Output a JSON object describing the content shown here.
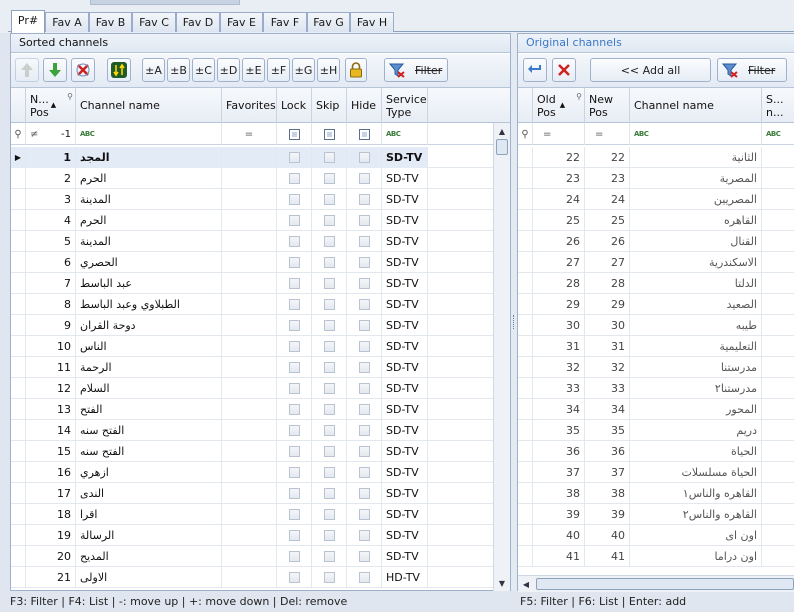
{
  "tabs": [
    {
      "label": "Pr#"
    },
    {
      "label": "Fav A"
    },
    {
      "label": "Fav B"
    },
    {
      "label": "Fav C"
    },
    {
      "label": "Fav D"
    },
    {
      "label": "Fav E"
    },
    {
      "label": "Fav F"
    },
    {
      "label": "Fav G"
    },
    {
      "label": "Fav H"
    }
  ],
  "sorted": {
    "title": "Sorted channels",
    "toolbar": {
      "fav_a": "±A",
      "fav_b": "±B",
      "fav_c": "±C",
      "fav_d": "±D",
      "fav_e": "±E",
      "fav_f": "±F",
      "fav_g": "±G",
      "fav_h": "±H",
      "filter": "Filter"
    },
    "columns": {
      "pos": "N...\nPos",
      "name": "Channel name",
      "favorites": "Favorites",
      "lock": "Lock",
      "skip": "Skip",
      "hide": "Hide",
      "service": "Service\nType"
    },
    "filter_row": {
      "neq": "≠",
      "pos_value": "-1",
      "eq": "="
    },
    "rows": [
      {
        "pos": "1",
        "name": "المجد",
        "type": "SD-TV"
      },
      {
        "pos": "2",
        "name": "الحرم",
        "type": "SD-TV"
      },
      {
        "pos": "3",
        "name": "المدينة",
        "type": "SD-TV"
      },
      {
        "pos": "4",
        "name": "الحرم",
        "type": "SD-TV"
      },
      {
        "pos": "5",
        "name": "المدينة",
        "type": "SD-TV"
      },
      {
        "pos": "6",
        "name": "الحصري",
        "type": "SD-TV"
      },
      {
        "pos": "7",
        "name": "عبد الباسط",
        "type": "SD-TV"
      },
      {
        "pos": "8",
        "name": "الطبلاوي وعبد الباسط",
        "type": "SD-TV"
      },
      {
        "pos": "9",
        "name": "دوحة القران",
        "type": "SD-TV"
      },
      {
        "pos": "10",
        "name": "الناس",
        "type": "SD-TV"
      },
      {
        "pos": "11",
        "name": "الرحمة",
        "type": "SD-TV"
      },
      {
        "pos": "12",
        "name": "السلام",
        "type": "SD-TV"
      },
      {
        "pos": "13",
        "name": "الفتح",
        "type": "SD-TV"
      },
      {
        "pos": "14",
        "name": "الفتح سنه",
        "type": "SD-TV"
      },
      {
        "pos": "15",
        "name": "الفتح سنه",
        "type": "SD-TV"
      },
      {
        "pos": "16",
        "name": "ازهري",
        "type": "SD-TV"
      },
      {
        "pos": "17",
        "name": "الندى",
        "type": "SD-TV"
      },
      {
        "pos": "18",
        "name": "اقرا",
        "type": "SD-TV"
      },
      {
        "pos": "19",
        "name": "الرسالة",
        "type": "SD-TV"
      },
      {
        "pos": "20",
        "name": "المديح",
        "type": "SD-TV"
      },
      {
        "pos": "21",
        "name": "الاولى",
        "type": "HD-TV"
      }
    ],
    "status": "F3: Filter | F4: List | -: move up | +: move down | Del: remove"
  },
  "original": {
    "title": "Original channels",
    "toolbar": {
      "add_all": "<< Add all",
      "filter": "Filter"
    },
    "columns": {
      "old_pos": "Old\nPos",
      "new_pos": "New\nPos",
      "name": "Channel name",
      "s": "S...\nn..."
    },
    "filter_row": {
      "eq": "="
    },
    "rows": [
      {
        "old": "22",
        "new": "22",
        "name": "الثانية"
      },
      {
        "old": "23",
        "new": "23",
        "name": "المصرية"
      },
      {
        "old": "24",
        "new": "24",
        "name": "المصريين"
      },
      {
        "old": "25",
        "new": "25",
        "name": "القاهره"
      },
      {
        "old": "26",
        "new": "26",
        "name": "القنال"
      },
      {
        "old": "27",
        "new": "27",
        "name": "الاسكندرية"
      },
      {
        "old": "28",
        "new": "28",
        "name": "الدلتا"
      },
      {
        "old": "29",
        "new": "29",
        "name": "الصعيد"
      },
      {
        "old": "30",
        "new": "30",
        "name": "طيبه"
      },
      {
        "old": "31",
        "new": "31",
        "name": "التعليمية"
      },
      {
        "old": "32",
        "new": "32",
        "name": "مدرستنا"
      },
      {
        "old": "33",
        "new": "33",
        "name": "مدرستنا٢"
      },
      {
        "old": "34",
        "new": "34",
        "name": "المحور"
      },
      {
        "old": "35",
        "new": "35",
        "name": "دريم"
      },
      {
        "old": "36",
        "new": "36",
        "name": "الحياة"
      },
      {
        "old": "37",
        "new": "37",
        "name": "الحياة مسلسلات"
      },
      {
        "old": "38",
        "new": "38",
        "name": "القاهره والناس١"
      },
      {
        "old": "39",
        "new": "39",
        "name": "القاهره والناس٢"
      },
      {
        "old": "40",
        "new": "40",
        "name": "اون اى"
      },
      {
        "old": "41",
        "new": "41",
        "name": "اون دراما"
      }
    ],
    "status": "F5: Filter | F6: List | Enter: add"
  },
  "colors": {
    "accent": "#3c78c8",
    "panel_border": "#9fb1cc",
    "selected_row": "#e3ebf7"
  }
}
